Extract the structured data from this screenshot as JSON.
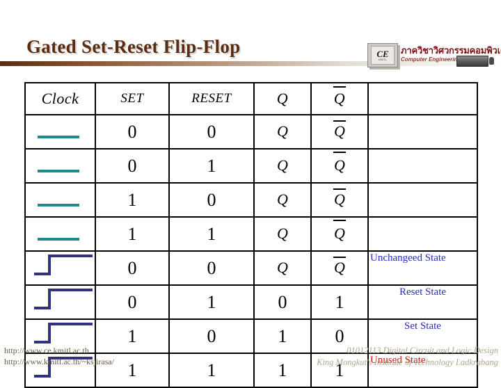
{
  "slide": {
    "title": "Gated Set-Reset Flip-Flop"
  },
  "logo": {
    "chip_text": "CE",
    "chip_sub": "KMITL",
    "thai_text": "ภาควิชาวิศวกรรมคอมพิวเตอร์",
    "english_text": "Computer Engineering"
  },
  "table": {
    "headers": {
      "clock": "Clock",
      "set": "SET",
      "reset": "RESET",
      "q": "Q",
      "qbar": "Q",
      "state": ""
    },
    "rows": [
      {
        "clock_type": "flat",
        "set": "0",
        "reset": "0",
        "q": "Q",
        "qbar": "Q",
        "q_type": "symbol",
        "state": "",
        "state_color": ""
      },
      {
        "clock_type": "flat",
        "set": "0",
        "reset": "1",
        "q": "Q",
        "qbar": "Q",
        "q_type": "symbol",
        "state": "",
        "state_color": ""
      },
      {
        "clock_type": "flat",
        "set": "1",
        "reset": "0",
        "q": "Q",
        "qbar": "Q",
        "q_type": "symbol",
        "state": "",
        "state_color": ""
      },
      {
        "clock_type": "flat",
        "set": "1",
        "reset": "1",
        "q": "Q",
        "qbar": "Q",
        "q_type": "symbol",
        "state": "",
        "state_color": ""
      },
      {
        "clock_type": "rising-edge",
        "set": "0",
        "reset": "0",
        "q": "Q",
        "qbar": "Q",
        "q_type": "symbol",
        "state": "Unchangeed State",
        "state_color": "#2b2bb4",
        "state_align": "left"
      },
      {
        "clock_type": "rising-edge",
        "set": "0",
        "reset": "1",
        "q": "0",
        "qbar": "1",
        "q_type": "digit",
        "state": "Reset State",
        "state_color": "#2b2bb4",
        "state_align": "center"
      },
      {
        "clock_type": "rising-edge",
        "set": "1",
        "reset": "0",
        "q": "1",
        "qbar": "0",
        "q_type": "digit",
        "state": "Set State",
        "state_color": "#2b2bb4",
        "state_align": "center"
      },
      {
        "clock_type": "rising-edge",
        "set": "1",
        "reset": "1",
        "q": "1",
        "qbar": "1",
        "q_type": "digit",
        "state": "Unused State",
        "state_color": "#c21a16",
        "state_align": "left"
      }
    ]
  },
  "footer": {
    "left_line1": "http://www.ce.kmitl.ac.th",
    "left_line2": "http://www.kmitl.ac.th/~ksjirasa/",
    "right_line1": "01012113 Digital Circuit and Logic Design",
    "right_line2": "King Mongkut's Institute of Technology Ladkrabang"
  },
  "colors": {
    "title": "#5a2d12",
    "clock_low": "#1e8a8a",
    "clock_pulse": "#31317e",
    "state_blue": "#2b2bb4",
    "state_red": "#c21a16"
  }
}
